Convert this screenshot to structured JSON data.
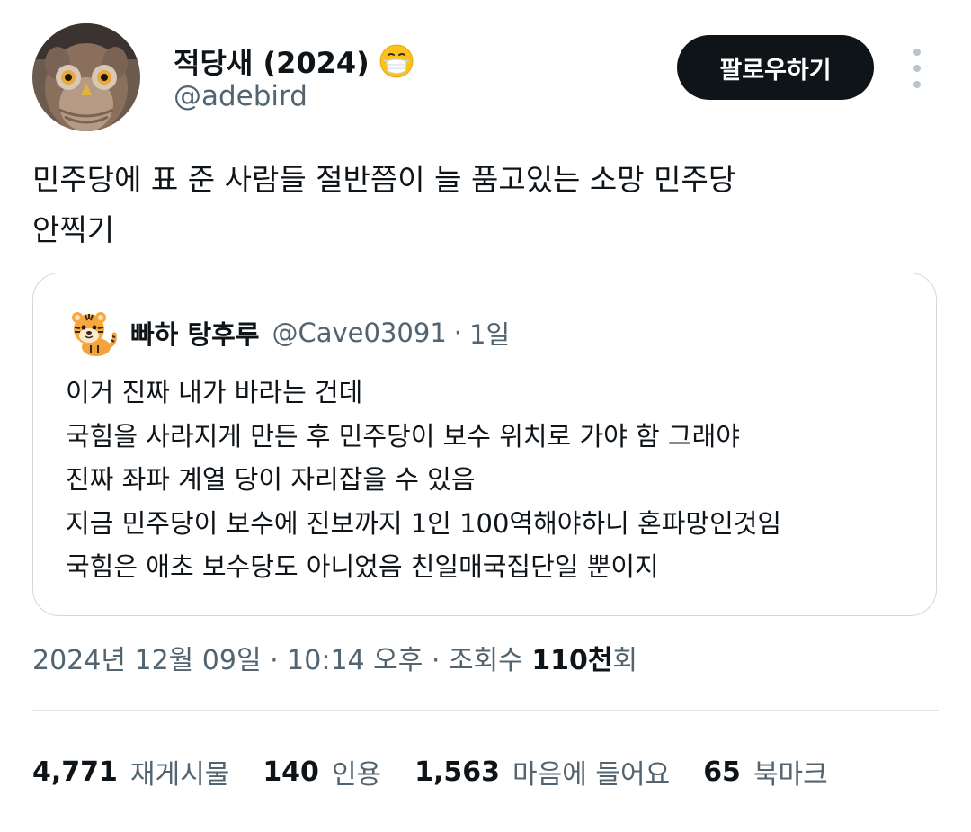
{
  "author": {
    "display_name": "적당새 (2024)",
    "badge_icon": "face-with-medical-mask-icon",
    "handle": "@adebird",
    "avatar_icon": "owl-avatar"
  },
  "follow_button": {
    "label": "팔로우하기"
  },
  "more_button": {
    "icon": "more-vertical-icon"
  },
  "tweet": {
    "lines": [
      "민주당에 표 준 사람들 절반쯤이 늘 품고있는 소망 민주당",
      "안찍기"
    ]
  },
  "quote": {
    "avatar_icon": "tiger-emoji-avatar",
    "name": "빠하 탕후루",
    "handle": "@Cave03091",
    "separator": "·",
    "time": "1일",
    "lines": [
      "이거 진짜 내가 바라는 건데",
      "국힘을 사라지게 만든 후 민주당이 보수 위치로 가야 함 그래야",
      "진짜 좌파 계열 당이 자리잡을 수 있음",
      "지금 민주당이 보수에 진보까지 1인 100역해야하니 혼파망인것임",
      "국힘은 애초 보수당도 아니었음 친일매국집단일 뿐이지"
    ]
  },
  "meta": {
    "timestamp": "2024년 12월 09일 · 10:14 오후 · 조회수 ",
    "views_number": "110천",
    "views_suffix": "회"
  },
  "stats": {
    "retweets": {
      "count": "4,771",
      "label": "재게시물"
    },
    "quotes": {
      "count": "140",
      "label": "인용"
    },
    "likes": {
      "count": "1,563",
      "label": "마음에 들어요"
    },
    "bookmarks": {
      "count": "65",
      "label": "북마크"
    }
  },
  "colors": {
    "text_primary": "#0f1419",
    "text_secondary": "#536471",
    "border": "#cfd9de",
    "button_bg": "#0f1419",
    "button_text": "#ffffff"
  }
}
